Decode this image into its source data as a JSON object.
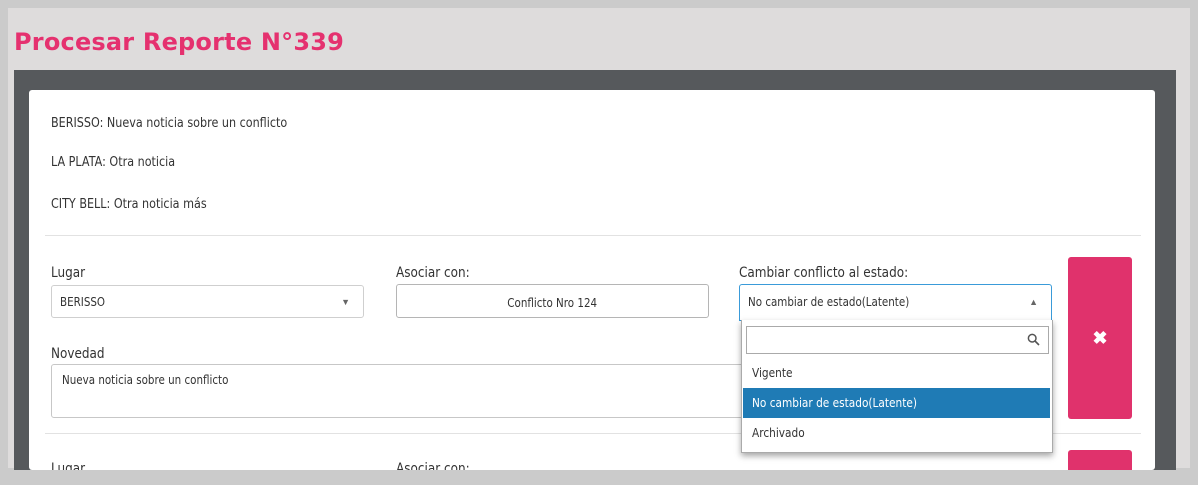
{
  "page": {
    "title": "Procesar Reporte N°339"
  },
  "news": [
    "BERISSO: Nueva noticia sobre un conflicto",
    "LA PLATA: Otra noticia",
    "CITY BELL: Otra noticia más"
  ],
  "entry": {
    "lugar_label": "Lugar",
    "lugar_value": "BERISSO",
    "asociar_label": "Asociar con:",
    "asociar_value": "Conflicto Nro 124",
    "estado_label": "Cambiar conflicto al estado:",
    "estado_value": "No cambiar de estado(Latente)",
    "novedad_label": "Novedad",
    "novedad_value": "Nueva noticia sobre un conflicto",
    "delete_icon": "✖"
  },
  "dropdown": {
    "search_value": "",
    "options": [
      "Vigente",
      "No cambiar de estado(Latente)",
      "Archivado"
    ],
    "selected_index": 1
  },
  "entry2": {
    "lugar_label": "Lugar",
    "asociar_label": "Asociar con:"
  },
  "colors": {
    "title": "#e5316f",
    "delete_button": "#e0326c",
    "selected_option": "#1f7bb5",
    "focus_border": "#3a9bd9"
  }
}
